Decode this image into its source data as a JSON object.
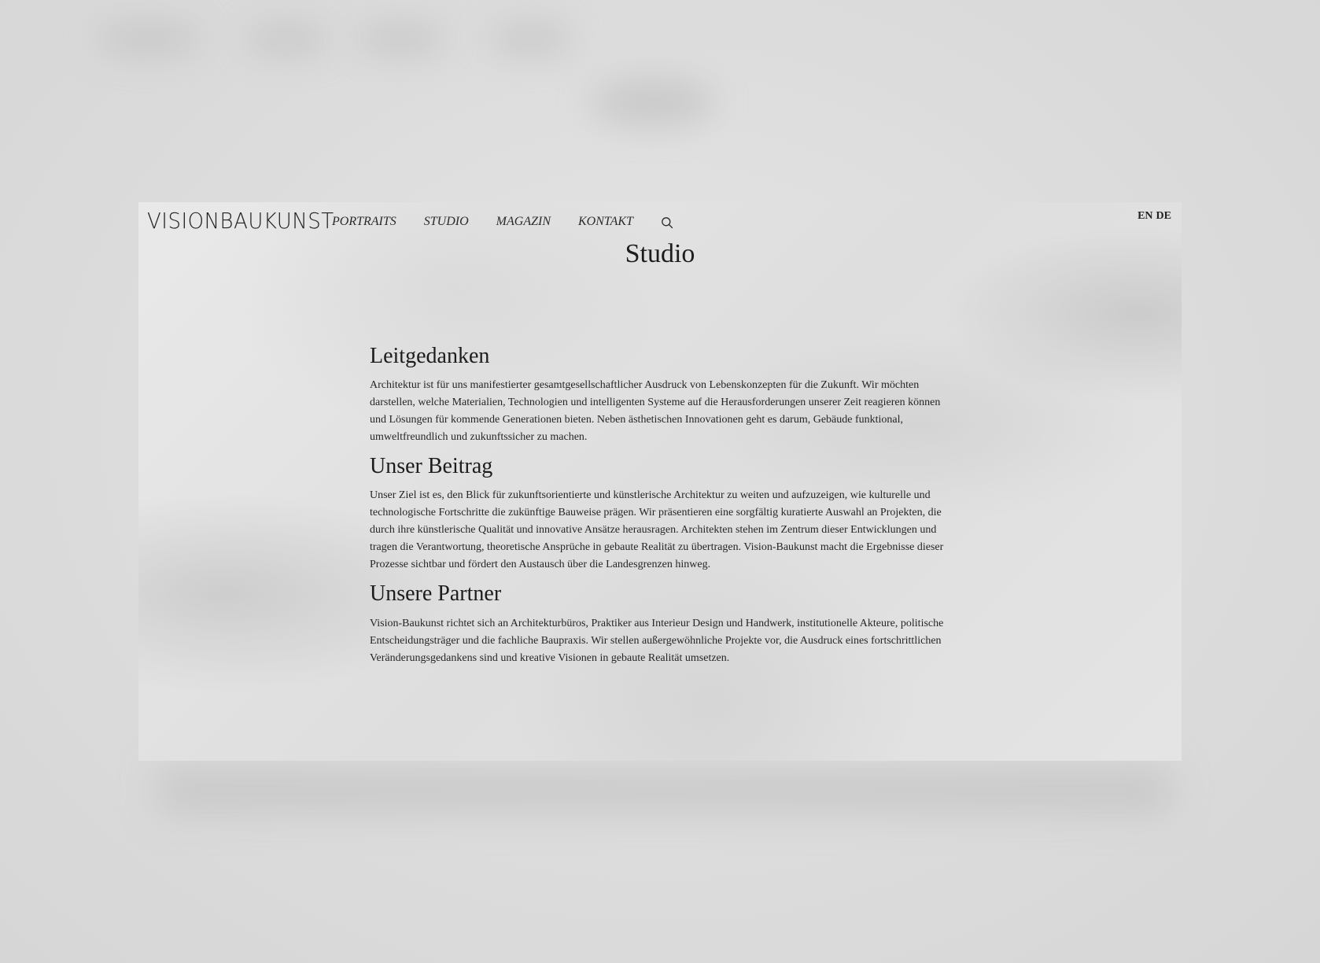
{
  "header": {
    "logo_text": "VISIONBAUKUNST",
    "nav": [
      {
        "label": "PORTRAITS"
      },
      {
        "label": "STUDIO"
      },
      {
        "label": "MAGAZIN"
      },
      {
        "label": "KONTAKT"
      }
    ],
    "search_icon": "search-icon",
    "languages": {
      "en": "EN",
      "de": "DE"
    }
  },
  "page": {
    "title": "Studio"
  },
  "sections": [
    {
      "heading": "Leitgedanken",
      "body": "Architektur ist für uns manifestierter gesamtgesellschaftlicher Ausdruck von Lebenskonzepten für die Zukunft. Wir möchten darstellen, welche Materialien, Technologien und intelligenten Systeme auf die Herausforderungen unserer Zeit reagieren können und Lösungen für kommende Generationen bieten. Neben ästhetischen Innovationen geht es darum, Gebäude funktional, umweltfreundlich und zukunftssicher zu machen."
    },
    {
      "heading": "Unser Beitrag",
      "body": "Unser Ziel ist es, den Blick für zukunftsorientierte und künstlerische Architektur zu weiten und aufzuzeigen, wie kulturelle und technologische Fortschritte die zukünftige Bauweise prägen. Wir präsentieren eine sorgfältig kuratierte Auswahl an Projekten, die durch ihre künstlerische Qualität und innovative Ansätze herausragen. Architekten stehen im Zentrum dieser Entwicklungen und tragen die Verantwortung, theoretische Ansprüche in gebaute Realität zu übertragen. Vision-Baukunst macht die Ergebnisse dieser Prozesse sichtbar und fördert den Austausch über die Landesgrenzen hinweg."
    },
    {
      "heading": "Unsere Partner",
      "body": "Vision-Baukunst richtet sich an Architekturbüros, Praktiker aus Interieur Design und Handwerk, institutionelle Akteure, politische Entscheidungsträger und die fachliche Baupraxis. Wir stellen außergewöhnliche Projekte vor, die Ausdruck eines fortschrittlichen Veränderungsgedankens sind und kreative Visionen in gebaute Realität umsetzen."
    }
  ]
}
